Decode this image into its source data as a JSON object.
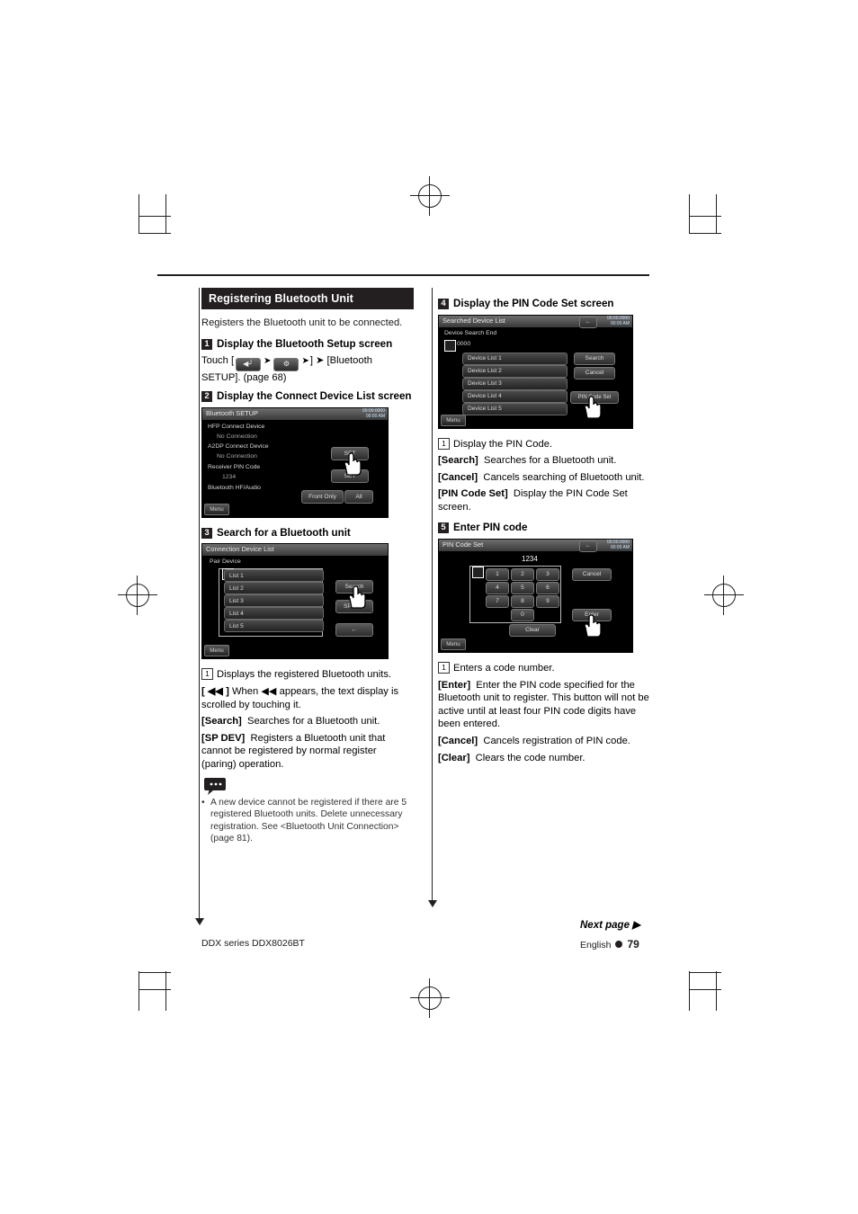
{
  "document": {
    "footer_left": "DDX series   DDX8026BT",
    "footer_language": "English",
    "page_number": "79",
    "next_page": "Next page ▶"
  },
  "left_column": {
    "section_title": "Registering Bluetooth Unit",
    "intro": "Registers the Bluetooth unit to be connected.",
    "steps": [
      {
        "num": "1",
        "title": "Display the Bluetooth Setup screen",
        "body_pre": "Touch [",
        "body_post": "] ➤ [Bluetooth SETUP]. (page 68)"
      },
      {
        "num": "2",
        "title": "Display the Connect Device List screen"
      },
      {
        "num": "3",
        "title": "Search for a Bluetooth unit"
      }
    ],
    "defs": [
      {
        "key": "1",
        "text": "Displays the registered Bluetooth units."
      },
      {
        "key": "[ ◀◀ ]",
        "text": "When ◀◀ appears, the text display is scrolled by touching it."
      },
      {
        "key": "[Search]",
        "text": "Searches for a Bluetooth unit."
      },
      {
        "key": "[SP DEV]",
        "text": "Registers a Bluetooth unit that cannot be registered by normal register (paring) operation."
      }
    ],
    "note": "A new device cannot be registered if there are 5 registered Bluetooth units. Delete unnecessary registration.  See <Bluetooth Unit Connection> (page 81)."
  },
  "right_column": {
    "steps": [
      {
        "num": "4",
        "title": "Display the PIN Code Set screen"
      },
      {
        "num": "5",
        "title": "Enter PIN code"
      }
    ],
    "defs_step4": [
      {
        "key": "1",
        "text": "Display the PIN Code."
      },
      {
        "key": "[Search]",
        "text": "Searches for a Bluetooth unit."
      },
      {
        "key": "[Cancel]",
        "text": "Cancels searching of Bluetooth unit."
      },
      {
        "key": "[PIN Code Set]",
        "text": "Display the PIN Code Set screen."
      }
    ],
    "defs_step5": [
      {
        "key": "1",
        "text": "Enters a code number."
      },
      {
        "key": "[Enter]",
        "text": "Enter the PIN code specified for the Bluetooth unit to register. This button will not be active until at least four PIN code digits have been entered."
      },
      {
        "key": "[Cancel]",
        "text": "Cancels registration of PIN code."
      },
      {
        "key": "[Clear]",
        "text": "Clears the code number."
      }
    ]
  },
  "screens": {
    "bluetooth_setup": {
      "title": "Bluetooth SETUP",
      "clock_line1": "00:00:0000",
      "clock_line2": "00:00 AM",
      "rows": [
        "HFP Connect Device",
        "No Connection",
        "A2DP Connect Device",
        "No Connection",
        "Receiver PIN Code",
        "1234",
        "Bluetooth HF/Audio"
      ],
      "set_button_1": "SET",
      "set_button_2": "SET",
      "front_only": "Front Only",
      "all": "All",
      "menu": "Menu"
    },
    "connection_device_list": {
      "title": "Connection Device List",
      "subtitle": "Pair Device",
      "list": [
        "List 1",
        "List 2",
        "List 3",
        "List 4",
        "List 5"
      ],
      "search": "Search",
      "sp_dev": "SP DEV",
      "menu": "Menu"
    },
    "searched_device_list": {
      "title": "Searched Device List",
      "subtitle": "Device Search End",
      "code": "0000",
      "clock_line1": "00:00:0000",
      "clock_line2": "00:00 AM",
      "list": [
        "Device List 1",
        "Device List 2",
        "Device List 3",
        "Device List 4",
        "Device List 5"
      ],
      "search": "Search",
      "cancel": "Cancel",
      "pin_code_set": "PIN Code Set",
      "menu": "Menu"
    },
    "pin_code_set": {
      "title": "PIN Code Set",
      "code": "1234",
      "clock_line1": "00:00:0000",
      "clock_line2": "00:00 AM",
      "keys": [
        "1",
        "2",
        "3",
        "4",
        "5",
        "6",
        "7",
        "8",
        "9",
        "0"
      ],
      "cancel": "Cancel",
      "enter": "Enter",
      "clear": "Clear",
      "menu": "Menu"
    }
  }
}
